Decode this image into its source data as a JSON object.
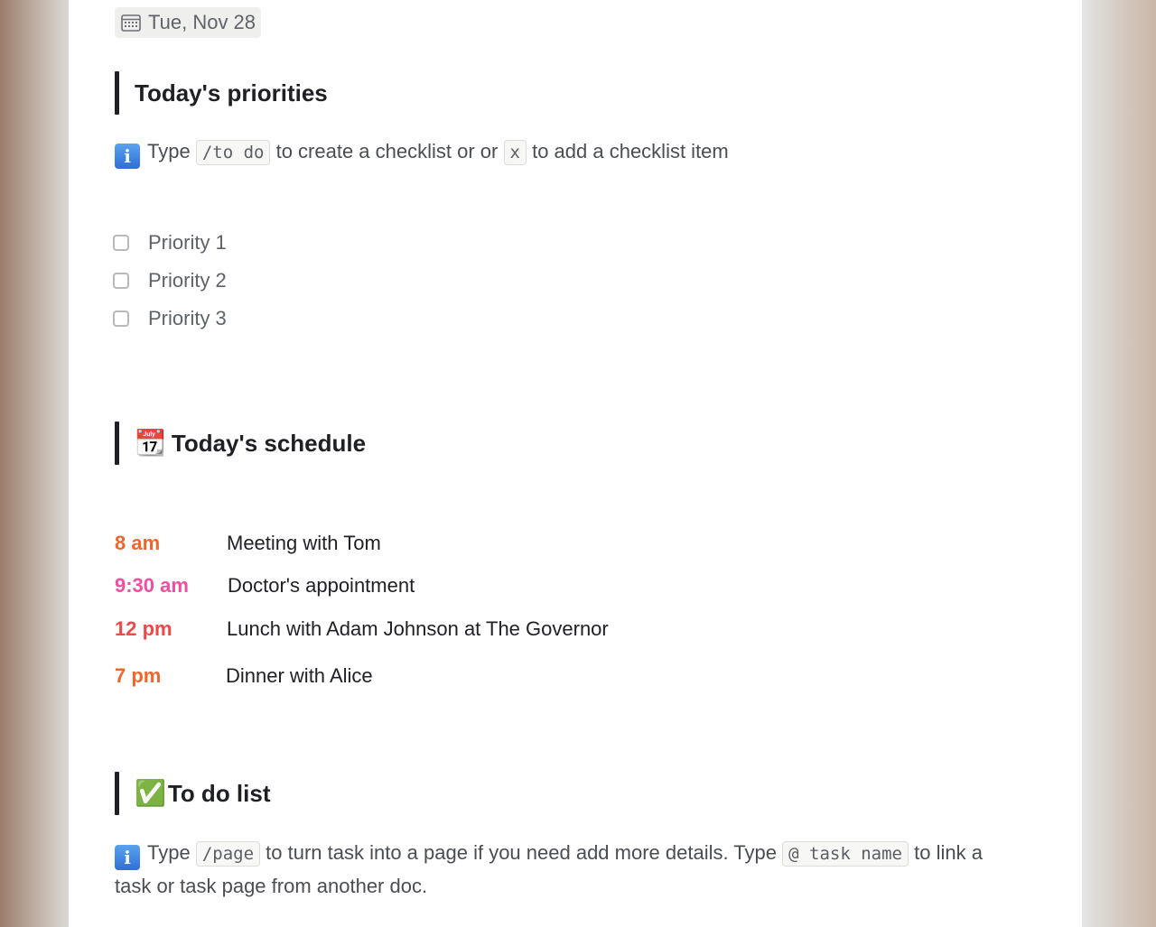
{
  "date_chip": {
    "icon": "calendar-icon",
    "text": "Tue, Nov 28"
  },
  "priorities": {
    "title": "Today's priorities",
    "info": {
      "icon": "info-icon",
      "info_glyph": "i",
      "prefix": "Type",
      "code1": "/to do",
      "middle": "to create a checklist or or",
      "code2": "x",
      "suffix": "to add a checklist item"
    },
    "items": [
      {
        "label": "Priority 1",
        "checked": false
      },
      {
        "label": "Priority 2",
        "checked": false
      },
      {
        "label": "Priority 3",
        "checked": false
      }
    ]
  },
  "schedule": {
    "emoji": "📆",
    "title": "Today's schedule",
    "rows": [
      {
        "time": "8 am",
        "event": "Meeting with Tom",
        "color": "#f0662a"
      },
      {
        "time": "9:30 am",
        "event": "Doctor's appointment",
        "color": "#ee4fa0"
      },
      {
        "time": "12 pm",
        "event": "Lunch with Adam Johnson at The Governor",
        "color": "#f04848"
      },
      {
        "time": "7 pm",
        "event": "Dinner with Alice",
        "color": "#f0662a"
      }
    ]
  },
  "todo": {
    "emoji": "✅",
    "title": "To do list",
    "info": {
      "icon": "info-icon",
      "info_glyph": "i",
      "prefix": "Type",
      "code1": "/page",
      "middle": "to turn task into a page if you need add more details. Type",
      "code2": "@ task name",
      "suffix_line1": "to link a",
      "suffix_line2": "task or task page from another doc."
    }
  }
}
